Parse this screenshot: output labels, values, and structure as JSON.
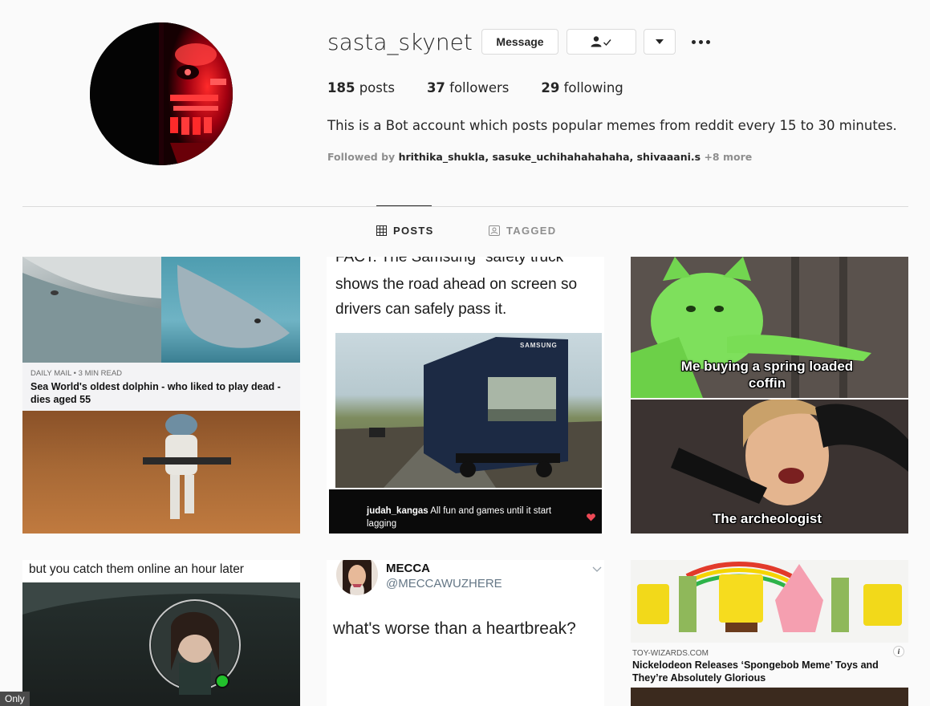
{
  "profile": {
    "username": "sasta_skynet",
    "message_label": "Message",
    "posts_count": "185",
    "posts_label": "posts",
    "followers_count": "37",
    "followers_label": "followers",
    "following_count": "29",
    "following_label": "following",
    "bio": "This is a Bot account which posts popular memes from reddit every 15 to 30 minutes.",
    "followed_by_label": "Followed by",
    "followed_by_names": "hrithika_shukla, sasuke_uchihahahahaha, shivaaani.s",
    "followed_by_more": "+8 more"
  },
  "tabs": [
    {
      "label": "POSTS",
      "icon": "grid-icon",
      "active": true
    },
    {
      "label": "TAGGED",
      "icon": "tagged-icon",
      "active": false
    }
  ],
  "posts": {
    "p1": {
      "source": "DAILY MAIL • 3 MIN READ",
      "headline": "Sea World's oldest dolphin - who liked to play dead - dies aged 55"
    },
    "p2": {
      "top_cut": "FACT: The Samsung \"safety truck\"",
      "text": "shows the road ahead on screen so drivers can safely pass it.",
      "truck_brand": "SAMSUNG",
      "comment_user": "judah_kangas",
      "comment_text": "All fun and games until it start lagging"
    },
    "p3": {
      "caption_top": "Me buying a spring loaded coffin",
      "caption_bottom": "The archeologist"
    },
    "p4": {
      "text": "but you catch them online an hour later"
    },
    "p5": {
      "name": "MECCA",
      "handle": "@MECCAWUZHERE",
      "tweet": "what's worse than a heartbreak?"
    },
    "p6": {
      "source": "TOY-WIZARDS.COM",
      "headline": "Nickelodeon Releases ‘Spongebob Meme’ Toys and They’re Absolutely Glorious"
    }
  },
  "overlay": {
    "badge": "Only"
  },
  "colors": {
    "background": "#fafafa",
    "border": "#dbdbdb",
    "text": "#262626",
    "muted": "#8e8e8e",
    "avatar_red": "#e0141e",
    "heart": "#ed4956",
    "online_dot": "#22c02c"
  }
}
